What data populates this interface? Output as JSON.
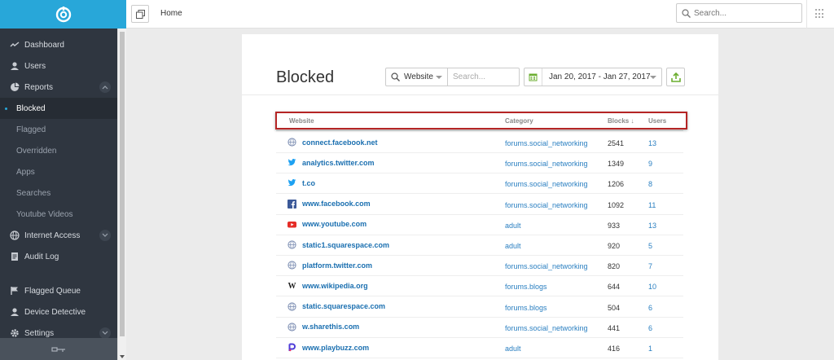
{
  "sidebar": {
    "logo_icon": "shield-logo-icon",
    "items": [
      {
        "label": "Dashboard",
        "icon": "trend-icon"
      },
      {
        "label": "Users",
        "icon": "user-icon"
      },
      {
        "label": "Reports",
        "icon": "pie-icon"
      },
      {
        "label": "Blocked"
      },
      {
        "label": "Flagged"
      },
      {
        "label": "Overridden"
      },
      {
        "label": "Apps"
      },
      {
        "label": "Searches"
      },
      {
        "label": "Youtube Videos"
      },
      {
        "label": "Internet Access",
        "icon": "globe-icon"
      },
      {
        "label": "Audit Log",
        "icon": "document-icon"
      },
      {
        "label": "Flagged Queue",
        "icon": "flag-icon"
      },
      {
        "label": "Device Detective",
        "icon": "user-icon"
      },
      {
        "label": "Settings",
        "icon": "gear-icon"
      }
    ]
  },
  "topbar": {
    "breadcrumb": "Home",
    "search_placeholder": "Search..."
  },
  "page": {
    "title": "Blocked",
    "filter_type": "Website",
    "filter_placeholder": "Search...",
    "date_range": "Jan 20, 2017 - Jan 27, 2017"
  },
  "table": {
    "columns": [
      "Website",
      "Category",
      "Blocks ↓",
      "Users"
    ],
    "rows": [
      {
        "website": "connect.facebook.net",
        "favicon": "globe-icon",
        "category": "forums.social_networking",
        "blocks": "2541",
        "users": "13"
      },
      {
        "website": "analytics.twitter.com",
        "favicon": "twitter-icon",
        "category": "forums.social_networking",
        "blocks": "1349",
        "users": "9"
      },
      {
        "website": "t.co",
        "favicon": "twitter-icon",
        "category": "forums.social_networking",
        "blocks": "1206",
        "users": "8"
      },
      {
        "website": "www.facebook.com",
        "favicon": "facebook-icon",
        "category": "forums.social_networking",
        "blocks": "1092",
        "users": "11"
      },
      {
        "website": "www.youtube.com",
        "favicon": "youtube-icon",
        "category": "adult",
        "blocks": "933",
        "users": "13"
      },
      {
        "website": "static1.squarespace.com",
        "favicon": "globe-icon",
        "category": "adult",
        "blocks": "920",
        "users": "5"
      },
      {
        "website": "platform.twitter.com",
        "favicon": "globe-icon",
        "category": "forums.social_networking",
        "blocks": "820",
        "users": "7"
      },
      {
        "website": "www.wikipedia.org",
        "favicon": "wikipedia-icon",
        "category": "forums.blogs",
        "blocks": "644",
        "users": "10"
      },
      {
        "website": "static.squarespace.com",
        "favicon": "globe-icon",
        "category": "forums.blogs",
        "blocks": "504",
        "users": "6"
      },
      {
        "website": "w.sharethis.com",
        "favicon": "globe-icon",
        "category": "forums.social_networking",
        "blocks": "441",
        "users": "6"
      },
      {
        "website": "www.playbuzz.com",
        "favicon": "playbuzz-icon",
        "category": "adult",
        "blocks": "416",
        "users": "1"
      }
    ]
  },
  "colors": {
    "brand": "#28a7d9",
    "sidebar_bg": "#2f3640",
    "link": "#1a6fb0",
    "highlight_border": "#b52525"
  }
}
